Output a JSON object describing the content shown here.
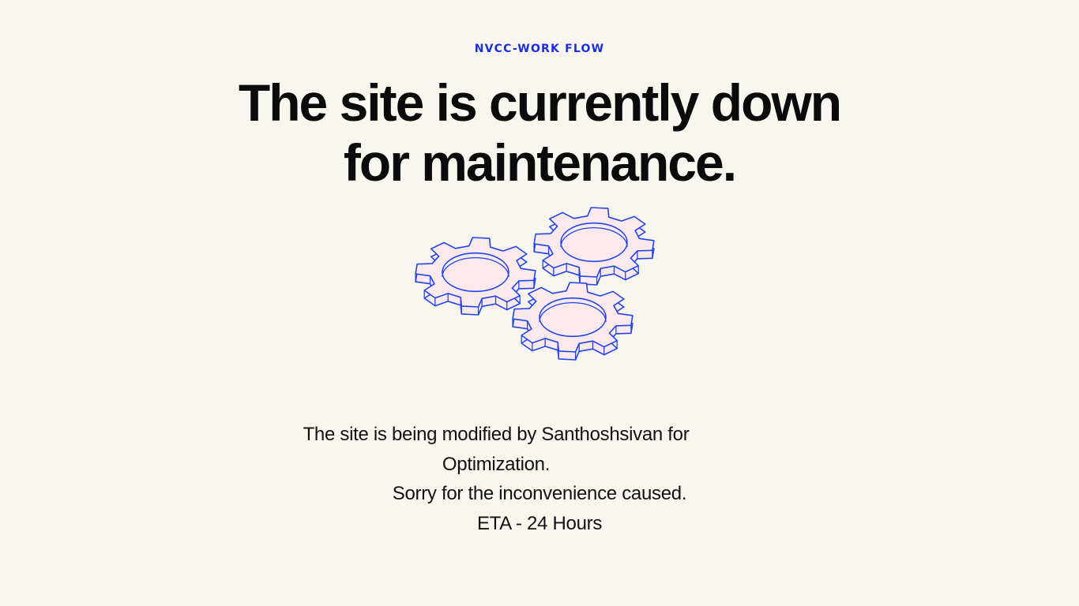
{
  "brand": {
    "label": "NVCC-WORK FLOW",
    "color": "#1b2fd6"
  },
  "headline": {
    "line1": "The site is currently down",
    "line2": "for maintenance."
  },
  "illustration": {
    "icon": "gears-icon",
    "count": 3,
    "stroke_color": "#2145e8",
    "fill_color": "#fbe9ee"
  },
  "message": {
    "line1": "The site is being modified by Santhoshsivan for Optimization.",
    "line2": "Sorry for the inconvenience caused.",
    "line3": "ETA - 24 Hours"
  },
  "colors": {
    "background": "#f9f6f0",
    "text": "#0b0b0b"
  }
}
